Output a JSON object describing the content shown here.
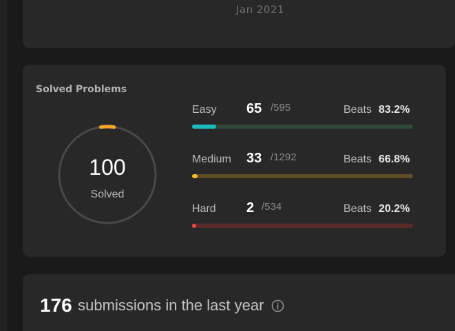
{
  "top_card": {
    "date": "Jan 2021"
  },
  "solved": {
    "title": "Solved Problems",
    "total": "100",
    "total_label": "Solved",
    "ring_progress": 0.045,
    "colors": {
      "ring_track": "#4a4a4a",
      "ring_progress": "#f4a72b"
    },
    "difficulties": [
      {
        "label": "Easy",
        "solved": "65",
        "total": "/595",
        "beats_label": "Beats",
        "beats": "83.2%",
        "progress": 0.109,
        "color": "#1cbaba",
        "track": "#2c4a37"
      },
      {
        "label": "Medium",
        "solved": "33",
        "total": "/1292",
        "beats_label": "Beats",
        "beats": "66.8%",
        "progress": 0.026,
        "color": "#f7b82b",
        "track": "#5c4e24"
      },
      {
        "label": "Hard",
        "solved": "2",
        "total": "/534",
        "beats_label": "Beats",
        "beats": "20.2%",
        "progress": 0.004,
        "color": "#ef4743",
        "track": "#5a2a29"
      }
    ]
  },
  "submissions": {
    "count": "176",
    "text": "submissions in the last year",
    "info_icon": "info-circle-icon"
  }
}
